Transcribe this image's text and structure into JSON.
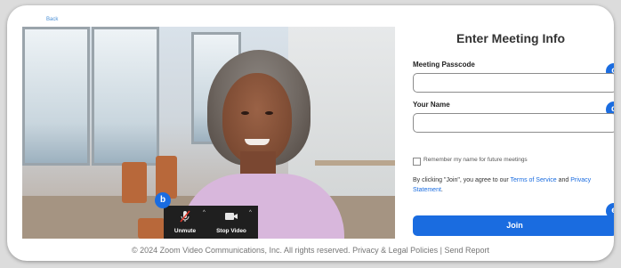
{
  "nav": {
    "back_label": "Back"
  },
  "video": {
    "toolbar": {
      "unmute_label": "Unmute",
      "stop_video_label": "Stop Video"
    }
  },
  "badges": {
    "b": "b",
    "c": "c",
    "d": "d",
    "e": "e"
  },
  "form": {
    "title": "Enter Meeting Info",
    "passcode_label": "Meeting Passcode",
    "passcode_value": "",
    "name_label": "Your Name",
    "name_value": "",
    "remember_label": "Remember my name for future meetings",
    "terms_prefix": "By clicking \"Join\", you agree to our ",
    "terms_link": "Terms of Service",
    "terms_and": " and ",
    "privacy_link": "Privacy Statement",
    "terms_suffix": ".",
    "join_label": "Join"
  },
  "footer": {
    "copyright": "© 2024 Zoom Video Communications, Inc. All rights reserved.",
    "privacy_link": "Privacy & Legal Policies",
    "separator": "|",
    "report_link": "Send Report"
  },
  "colors": {
    "accent": "#1a6ce0",
    "toolbar": "#1f1f1f"
  }
}
